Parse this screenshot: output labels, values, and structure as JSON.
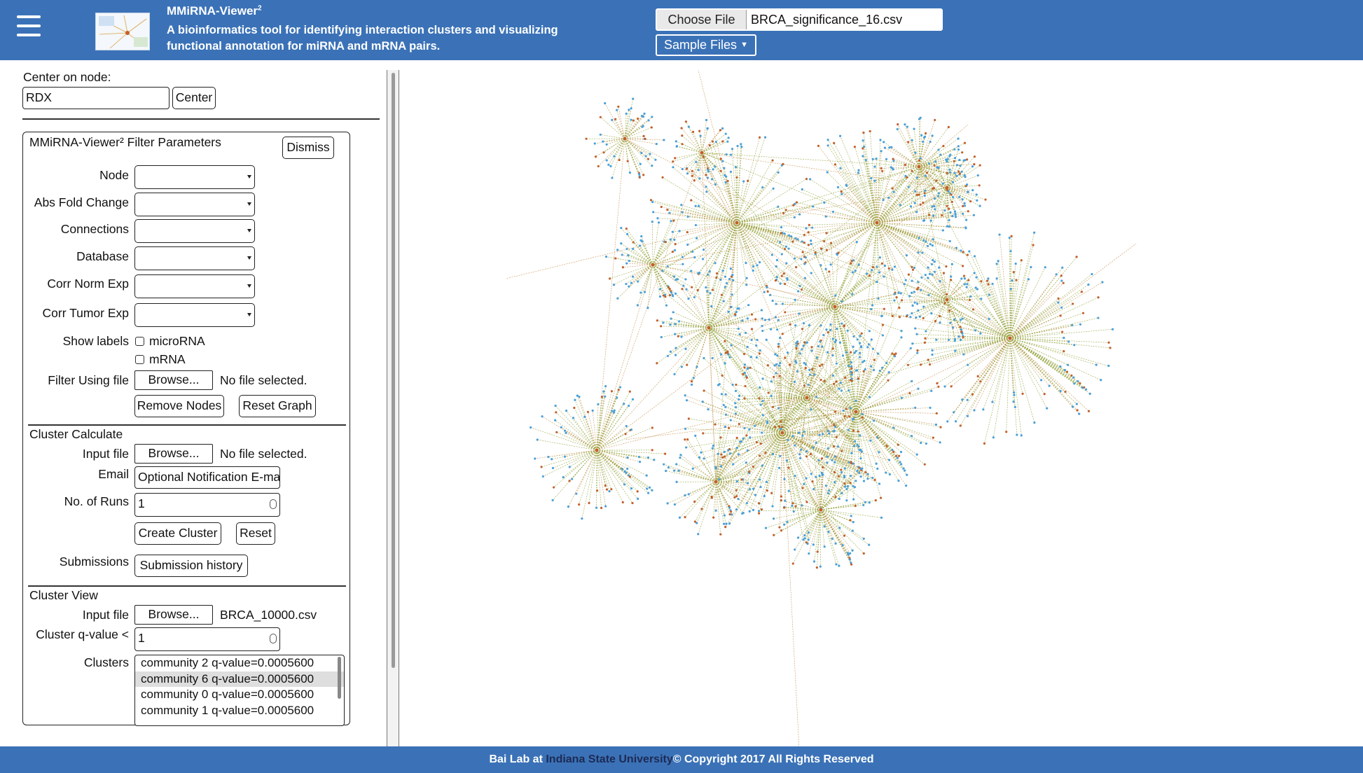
{
  "header": {
    "title": "MMiRNA-Viewer",
    "title_sup": "2",
    "description": "A bioinformatics tool for identifying interaction clusters and visualizing functional annotation for miRNA and mRNA pairs.",
    "choose_file_label": "Choose File",
    "chosen_file": "BRCA_significance_16.csv",
    "sample_files_label": "Sample Files"
  },
  "center": {
    "label": "Center on node:",
    "value": "RDX",
    "button": "Center"
  },
  "filter": {
    "title": "MMiRNA-Viewer² Filter Parameters",
    "dismiss": "Dismiss",
    "fields": [
      "Node",
      "Abs Fold Change",
      "Connections",
      "Database",
      "Corr Norm Exp",
      "Corr Tumor Exp"
    ],
    "show_labels": "Show labels",
    "mirna_label": "microRNA",
    "mrna_label": "mRNA",
    "filter_file_label": "Filter Using file",
    "browse": "Browse...",
    "no_file": "No file selected.",
    "remove_nodes": "Remove Nodes",
    "reset_graph": "Reset Graph"
  },
  "cluster_calc": {
    "title": "Cluster Calculate",
    "input_file_label": "Input file",
    "browse": "Browse...",
    "no_file": "No file selected.",
    "email_label": "Email",
    "email_placeholder": "Optional Notification E-mail",
    "runs_label": "No. of Runs",
    "runs_value": "1",
    "create_cluster": "Create Cluster",
    "reset": "Reset",
    "submissions_label": "Submissions",
    "submission_history": "Submission history"
  },
  "cluster_view": {
    "title": "Cluster View",
    "input_file_label": "Input file",
    "browse": "Browse...",
    "file_name": "BRCA_10000.csv",
    "qvalue_label": "Cluster q-value <",
    "qvalue": "1",
    "clusters_label": "Clusters",
    "clusters": [
      "community 2 q-value=0.0005600",
      "community 6 q-value=0.0005600",
      "community 0 q-value=0.0005600",
      "community 1 q-value=0.0005600"
    ],
    "selected_index": 1
  },
  "footer": {
    "prefix": "Bai Lab at ",
    "university": "Indiana State University",
    "suffix": "© Copyright 2017 All Rights Reserved"
  },
  "colors": {
    "header_bg": "#3b72b7",
    "edge": "#8a9a2a",
    "edge_alt": "#c0843a",
    "hub_node": "#c2602a",
    "leaf_node": "#4aa0d8"
  }
}
